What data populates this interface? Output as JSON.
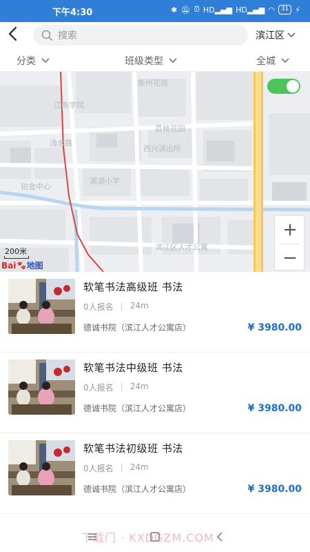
{
  "status_bar": {
    "time": "下午4:30",
    "network_labels": [
      "HD",
      "HD"
    ],
    "battery": "31"
  },
  "top_bar": {
    "search_placeholder": "搜索",
    "district": "滨江区"
  },
  "filters": {
    "category": "分类",
    "class_type": "班级类型",
    "area": "全城"
  },
  "map": {
    "toggle_on": true,
    "zoom_in": "+",
    "zoom_out": "−",
    "scale_label": "200米",
    "logo_red": "Bai",
    "logo_blue": "地图",
    "place_labels": [
      "新州花苑",
      "江南学院",
      "浅水路",
      "荔枝花园",
      "西兴派出所",
      "铂金中心",
      "湘湖小学",
      "滨江区人才公寓"
    ]
  },
  "courses": [
    {
      "title": "软笔书法高级班   书法",
      "enrolled": "0人报名",
      "distance": "24m",
      "school": "德诚书院（滨江人才公寓店）",
      "price": "¥ 3980.00"
    },
    {
      "title": "软笔书法中级班   书法",
      "enrolled": "0人报名",
      "distance": "24m",
      "school": "德诚书院（滨江人才公寓店）",
      "price": "¥ 3980.00"
    },
    {
      "title": "软笔书法初级班   书法",
      "enrolled": "0人报名",
      "distance": "24m",
      "school": "德诚书院（滨江人才公寓店）",
      "price": "¥ 3980.00"
    }
  ],
  "nav": {
    "watermark": "下载门 · KXDGZM.COM"
  },
  "colors": {
    "status_bar": "#2f7fd8",
    "price": "#1b6fd1",
    "toggle": "#4cc55a",
    "route": "#e0433e",
    "main_road": "#f5c65a"
  },
  "icons": [
    "back-arrow-icon",
    "search-icon",
    "chevron-down-icon",
    "bluetooth-icon",
    "mute-icon",
    "alarm-icon",
    "signal-icon",
    "wifi-icon",
    "battery-icon",
    "charging-icon"
  ]
}
